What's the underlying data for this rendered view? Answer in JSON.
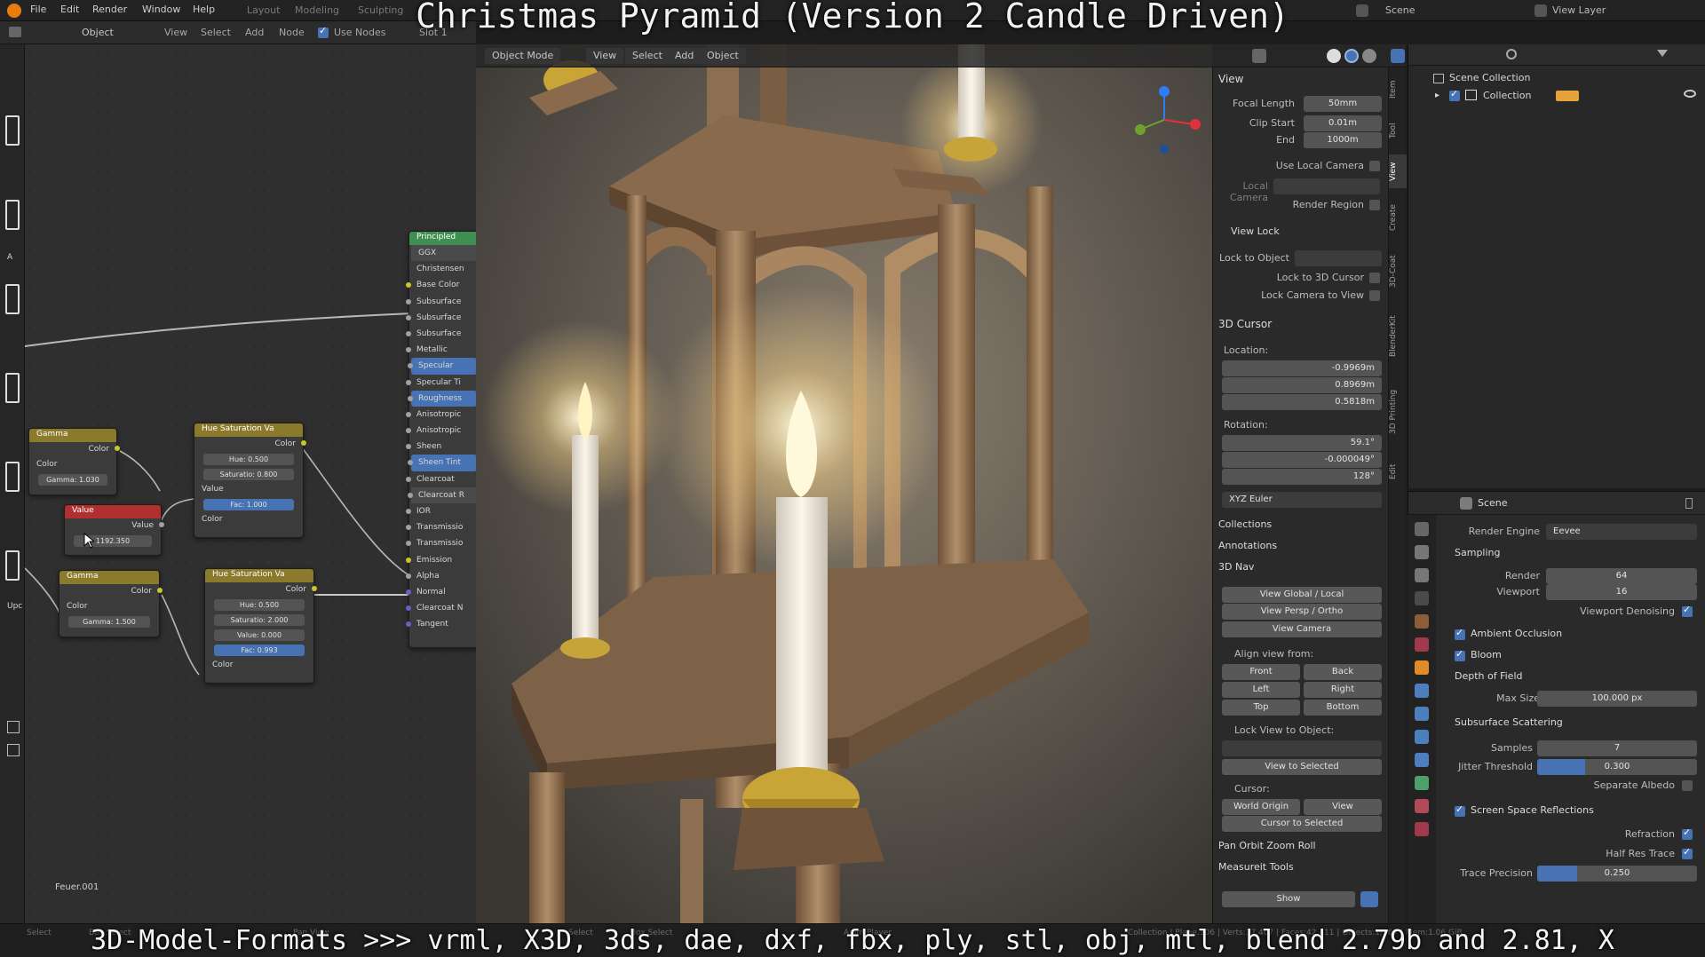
{
  "overlay": {
    "title": "Christmas Pyramid (Version 2 Candle Driven)",
    "footer": "3D-Model-Formats >>> vrml, X3D, 3ds, dae, dxf, fbx, ply, stl, obj, mtl, blend 2.79b and 2.81, X"
  },
  "menu": [
    "File",
    "Edit",
    "Render",
    "Window",
    "Help"
  ],
  "workspaces": [
    "Layout",
    "Modeling",
    "Sculpting"
  ],
  "top_right": {
    "scene": "Scene",
    "view_layer": "View Layer"
  },
  "node_header": {
    "object_label": "Object",
    "menus": [
      "View",
      "Select",
      "Add",
      "Node"
    ],
    "use_nodes": "Use Nodes",
    "slot": "Slot 1"
  },
  "viewport_header": {
    "mode": "Object Mode",
    "menus": [
      "View",
      "Select",
      "Add",
      "Object"
    ]
  },
  "nodes": {
    "principled": {
      "title": "Principled",
      "sockets": [
        "GGX",
        "Christensen",
        "Base Color",
        "Subsurface",
        "Subsurface",
        "Subsurface",
        "Metallic",
        "Specular",
        "Specular Ti",
        "Roughness",
        "Anisotropic",
        "Anisotropic",
        "Sheen",
        "Sheen Tint",
        "Clearcoat",
        "Clearcoat R",
        "IOR",
        "Transmissio",
        "Transmissio",
        "Emission",
        "Alpha",
        "Normal",
        "Clearcoat N",
        "Tangent"
      ]
    },
    "gamma1": {
      "title": "Gamma",
      "out": "Color",
      "in": "Color",
      "field": "Gamma: 1.030"
    },
    "value": {
      "title": "Value",
      "out": "Value",
      "field": "1192.350"
    },
    "gamma2": {
      "title": "Gamma",
      "out": "Color",
      "in": "Color",
      "field": "Gamma: 1.500"
    },
    "hue1": {
      "title": "Hue Saturation Va",
      "out": "Color",
      "hue": "Hue: 0.500",
      "sat": "Saturatio: 0.800",
      "value": "Value",
      "fac": "Fac: 1.000",
      "color": "Color"
    },
    "hue2": {
      "title": "Hue Saturation Va",
      "out": "Color",
      "hue": "Hue: 0.500",
      "sat": "Saturatio: 2.000",
      "value": "Value: 0.000",
      "fac": "Fac: 0.993",
      "color": "Color"
    },
    "footer_label": "Feuer.001",
    "left_label_a": "A",
    "left_label_upc": "Upc"
  },
  "npanel": {
    "view": {
      "title": "View",
      "focal_label": "Focal Length",
      "focal": "50mm",
      "clip_start_label": "Clip Start",
      "clip_start": "0.01m",
      "end_label": "End",
      "end": "1000m",
      "use_local_camera": "Use Local Camera",
      "local_camera": "Local Camera",
      "render_region": "Render Region"
    },
    "view_lock": {
      "title": "View Lock",
      "lock_object": "Lock to Object",
      "lock_cursor": "Lock to 3D Cursor",
      "lock_camera": "Lock Camera to View"
    },
    "cursor": {
      "title": "3D Cursor",
      "location": "Location:",
      "x": "-0.9969m",
      "y": "0.8969m",
      "z": "0.5818m",
      "rotation": "Rotation:",
      "rx": "59.1°",
      "ry": "-0.000049°",
      "rz": "128°",
      "mode": "XYZ Euler"
    },
    "collections": "Collections",
    "annotations": "Annotations",
    "nav": {
      "title": "3D Nav",
      "global_local": "View Global / Local",
      "persp_ortho": "View Persp / Ortho",
      "view_camera": "View Camera",
      "align_from": "Align view from:",
      "front": "Front",
      "back": "Back",
      "left": "Left",
      "right": "Right",
      "top": "Top",
      "bottom": "Bottom",
      "lock_view": "Lock View to Object:",
      "view_selected": "View to Selected",
      "cursor": "Cursor:",
      "world_origin": "World Origin",
      "view": "View",
      "cursor_selected": "Cursor to Selected"
    },
    "pan_orbit": "Pan Orbit Zoom Roll",
    "measure": "Measureit Tools",
    "show": "Show",
    "tabs": [
      "Item",
      "Tool",
      "View",
      "Create",
      "3D-Coat",
      "BlenderKit",
      "3D Printing",
      "Edit"
    ]
  },
  "outliner": {
    "scene_collection": "Scene Collection",
    "collection": "Collection"
  },
  "props": {
    "scene": "Scene",
    "render_engine_label": "Render Engine",
    "render_engine": "Eevee",
    "sampling": "Sampling",
    "render_label": "Render",
    "render": "64",
    "viewport_label": "Viewport",
    "viewport": "16",
    "viewport_denoising": "Viewport Denoising",
    "ao": "Ambient Occlusion",
    "bloom": "Bloom",
    "dof": "Depth of Field",
    "max_size_label": "Max Size",
    "max_size": "100.000 px",
    "sss": "Subsurface Scattering",
    "samples_label": "Samples",
    "samples": "7",
    "jitter_label": "Jitter Threshold",
    "jitter": "0.300",
    "jitter_fill": 0.3,
    "separate_albedo": "Separate Albedo",
    "ssr": "Screen Space Reflections",
    "refraction": "Refraction",
    "half_res": "Half Res Trace",
    "trace_label": "Trace Precision",
    "trace": "0.250",
    "trace_fill": 0.25
  },
  "status": {
    "left": "Select",
    "left2": "Box Select",
    "mid": "Pan View",
    "mid2": "Select",
    "mid3": "Box Select",
    "anim": "Anim Player",
    "right": "Collection | Plane.106 | Verts:37,407 | Faces:42,411 | Objects:1/167 | Mem:1.06 GiB"
  }
}
